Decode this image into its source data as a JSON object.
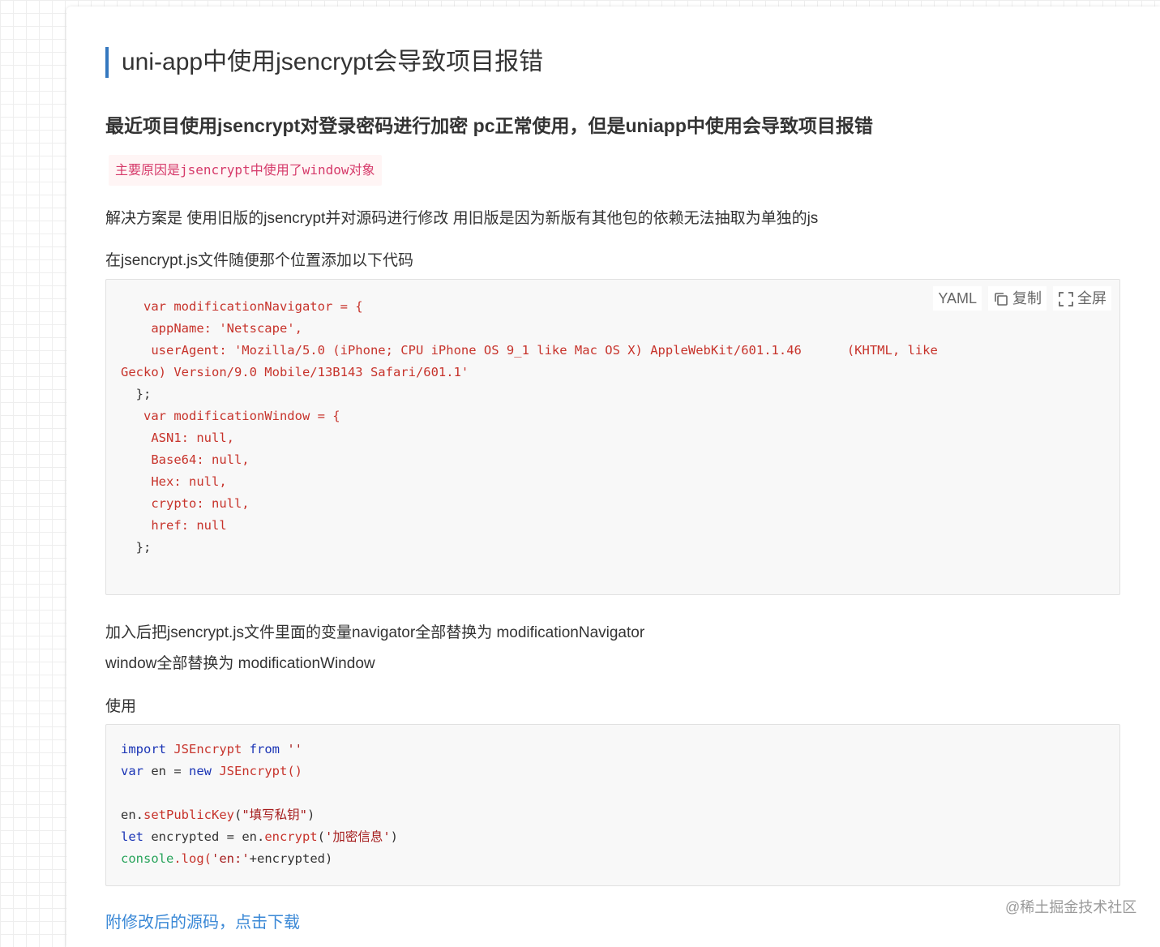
{
  "article": {
    "title": "uni-app中使用jsencrypt会导致项目报错",
    "subhead": "最近项目使用jsencrypt对登录密码进行加密 pc正常使用，但是uniapp中使用会导致项目报错",
    "inline_note": "主要原因是jsencrypt中使用了window对象",
    "p1": "解决方案是 使用旧版的jsencrypt并对源码进行修改 用旧版是因为新版有其他包的依赖无法抽取为单独的js",
    "p2": "在jsencrypt.js文件随便那个位置添加以下代码",
    "p3_line1": "加入后把jsencrypt.js文件里面的变量navigator全部替换为 modificationNavigator",
    "p3_line2": "window全部替换为 modificationWindow",
    "p4": "使用",
    "download_link": "附修改后的源码，点击下载"
  },
  "code_block_1": {
    "language": "YAML",
    "copy_label": "复制",
    "fullscreen_label": "全屏",
    "lines": [
      "   var modificationNavigator = {",
      "    appName: 'Netscape',",
      "    userAgent: 'Mozilla/5.0 (iPhone; CPU iPhone OS 9_1 like Mac OS X) AppleWebKit/601.1.46      (KHTML, like",
      "Gecko) Version/9.0 Mobile/13B143 Safari/601.1'",
      "  };",
      "   var modificationWindow = {",
      "    ASN1: null,",
      "    Base64: null,",
      "    Hex: null,",
      "    crypto: null,",
      "    href: null",
      "  };"
    ]
  },
  "code_block_2": {
    "line1": [
      "import",
      " JSEncrypt ",
      "from",
      " ''"
    ],
    "line2": [
      "var",
      " en = ",
      "new",
      " JSEncrypt()"
    ],
    "line3": [
      "en.",
      "setPublicKey",
      "(",
      "\"填写私钥\"",
      ")"
    ],
    "line4": [
      "let",
      " encrypted = en.",
      "encrypt",
      "(",
      "'加密信息'",
      ")"
    ],
    "line5": [
      "console",
      ".log(",
      "'en:'",
      "+encrypted)"
    ]
  },
  "watermark": "@稀土掘金技术社区",
  "colors": {
    "title_bar": "#3478bf",
    "inline_code_text": "#d63a6a",
    "code_red": "#c7332b",
    "code_keyword": "#1a34b5",
    "code_green": "#27a35a",
    "link": "#3a88d6"
  },
  "icons": [
    "copy-icon",
    "fullscreen-icon"
  ]
}
